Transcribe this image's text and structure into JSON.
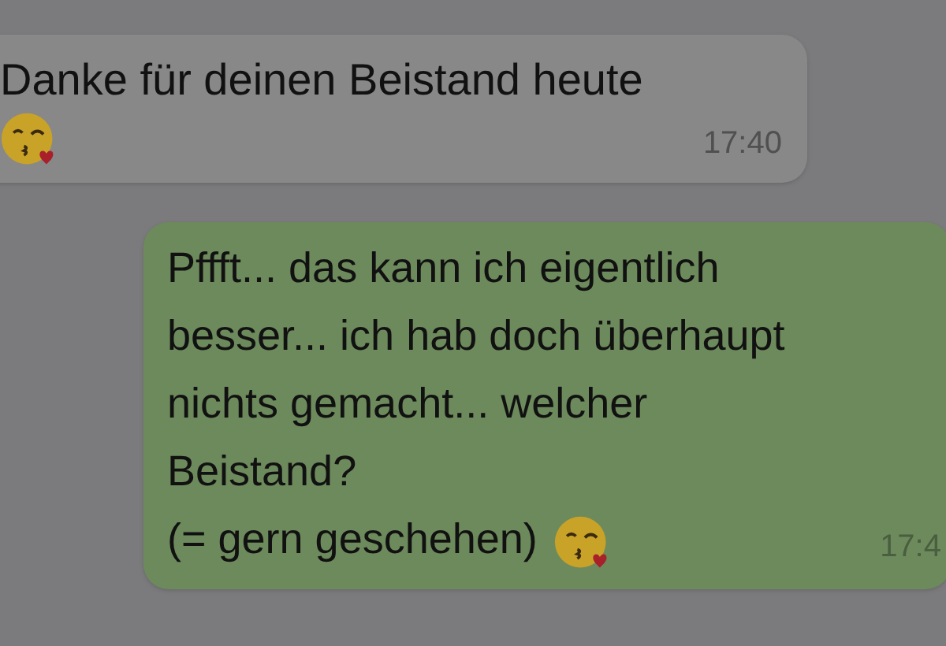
{
  "messages": [
    {
      "kind": "incoming",
      "text": "Danke für deinen Beistand heute",
      "emoji": true,
      "time": "17:40"
    },
    {
      "kind": "outgoing",
      "text": "Pffft... das kann ich eigentlich\nbesser... ich hab doch überhaupt\nnichts gemacht... welcher\nBeistand?\n(= gern geschehen)",
      "emoji": true,
      "time": "17:4"
    }
  ]
}
